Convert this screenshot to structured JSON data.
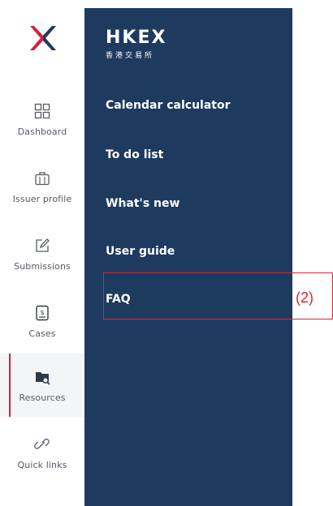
{
  "sidebar": {
    "items": [
      {
        "label": "Dashboard",
        "icon": "dashboard-grid-icon"
      },
      {
        "label": "Issuer profile",
        "icon": "briefcase-icon"
      },
      {
        "label": "Submissions",
        "icon": "edit-square-icon"
      },
      {
        "label": "Cases",
        "icon": "document-dollar-icon"
      },
      {
        "label": "Resources",
        "icon": "folder-search-icon",
        "active": true
      },
      {
        "label": "Quick links",
        "icon": "link-icon"
      }
    ]
  },
  "brand": {
    "name": "HKEX",
    "subtitle": "香港交易所"
  },
  "menu": {
    "items": [
      {
        "label": "Calendar calculator"
      },
      {
        "label": "To do list"
      },
      {
        "label": "What's new"
      },
      {
        "label": "User guide"
      },
      {
        "label": "FAQ"
      }
    ]
  },
  "annotation": {
    "label": "(2)"
  },
  "colors": {
    "panel": "#1f3a5f",
    "accent": "#d4203c",
    "annotation": "#e0242f",
    "logo": "#1f3a5f"
  }
}
